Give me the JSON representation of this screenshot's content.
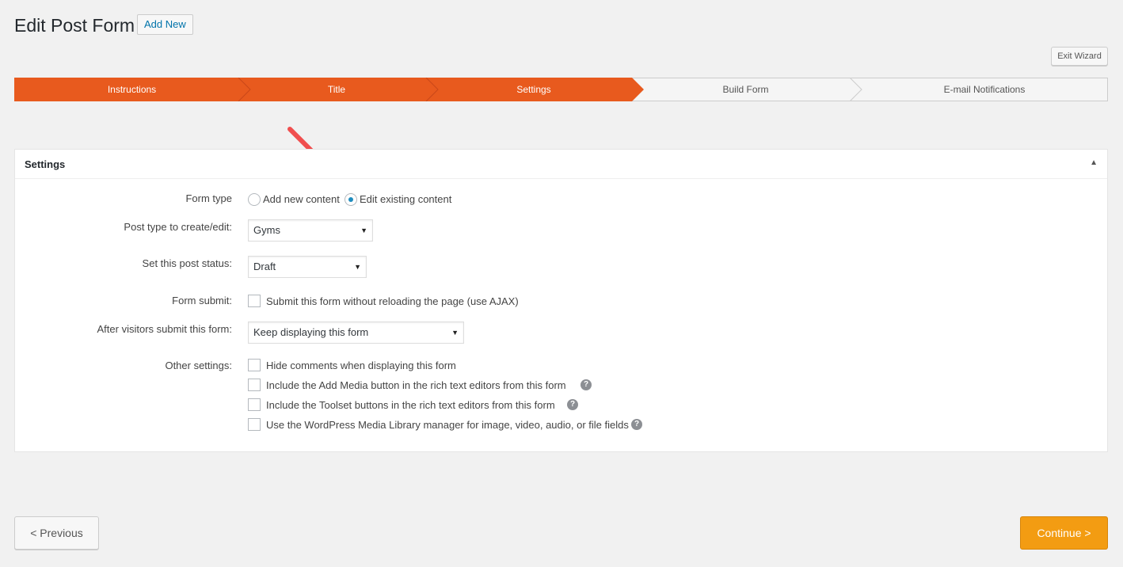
{
  "header": {
    "title": "Edit Post Form",
    "add_new_label": "Add New",
    "exit_wizard_label": "Exit Wizard"
  },
  "wizard": {
    "steps": [
      {
        "label": "Instructions",
        "active": true
      },
      {
        "label": "Title",
        "active": true
      },
      {
        "label": "Settings",
        "active": true
      },
      {
        "label": "Build Form",
        "active": false
      },
      {
        "label": "E-mail Notifications",
        "active": false
      }
    ],
    "active_color": "#e85a1e",
    "inactive_color": "#f5f5f5"
  },
  "settings": {
    "title": "Settings",
    "toggle_icon": "triangle-up-icon",
    "form_type": {
      "label": "Form type",
      "options": [
        {
          "label": "Add new content",
          "checked": false
        },
        {
          "label": "Edit existing content",
          "checked": true
        }
      ]
    },
    "post_type": {
      "label": "Post type to create/edit:",
      "value": "Gyms"
    },
    "post_status": {
      "label": "Set this post status:",
      "value": "Draft"
    },
    "form_submit": {
      "label": "Form submit:",
      "option": "Submit this form without reloading the page (use AJAX)"
    },
    "after_submit": {
      "label": "After visitors submit this form:",
      "value": "Keep displaying this form"
    },
    "other_settings": {
      "label": "Other settings:",
      "options": [
        {
          "label": "Hide comments when displaying this form",
          "help": false
        },
        {
          "label": "Include the Add Media button in the rich text editors from this form",
          "help": true
        },
        {
          "label": "Include the Toolset buttons in the rich text editors from this form",
          "help": true
        },
        {
          "label": "Use the WordPress Media Library manager for image, video, audio, or file fields",
          "help": true
        }
      ]
    }
  },
  "footer": {
    "previous_label": "< Previous",
    "continue_label": "Continue >",
    "continue_color": "#f39c12"
  },
  "annotation": {
    "arrow_color": "#f04e4e",
    "icon": "red-pointer-arrow-icon"
  }
}
